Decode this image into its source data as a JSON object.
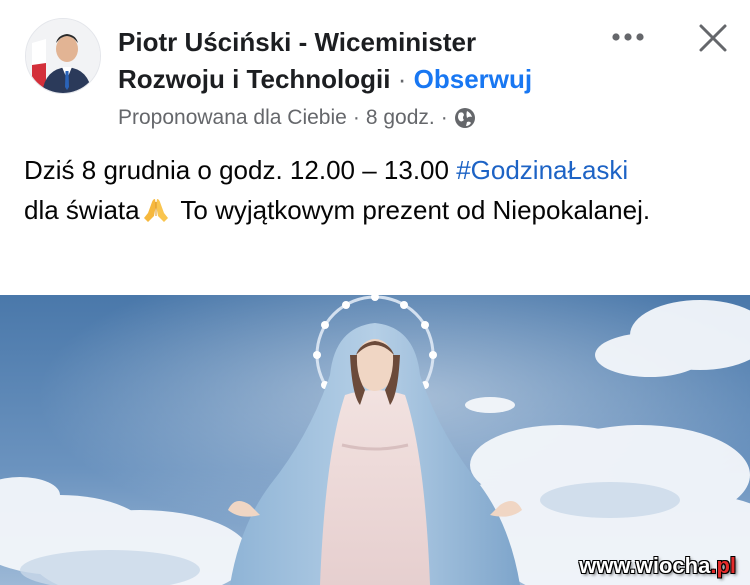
{
  "post": {
    "author_name": "Piotr Uściński - Wiceminister Rozwoju i Technologii",
    "separator": "·",
    "follow_label": "Obserwuj",
    "suggested_label": "Proponowana dla Ciebie",
    "time_label": "8 godz.",
    "meta_separator": "·",
    "audience_icon": "globe-icon",
    "more_icon": "more-horizontal-icon",
    "close_icon": "close-icon",
    "text_part1": "Dziś 8 grudnia o godz. 12.00 – 13.00",
    "hashtag": "#GodzinaŁaski",
    "text_part2": "dla świata",
    "emoji": "folded-hands-emoji",
    "text_part3": "To wyjątkowym prezent od Niepokalanej.",
    "image_subject": "statue-of-mary-sky-photo"
  },
  "watermark": {
    "main": "www.wiocha",
    "suffix": ".pl"
  },
  "colors": {
    "link": "#1877f2",
    "hashtag": "#1d63c5",
    "secondary_text": "#65676b",
    "sky": "#5d86b3"
  }
}
